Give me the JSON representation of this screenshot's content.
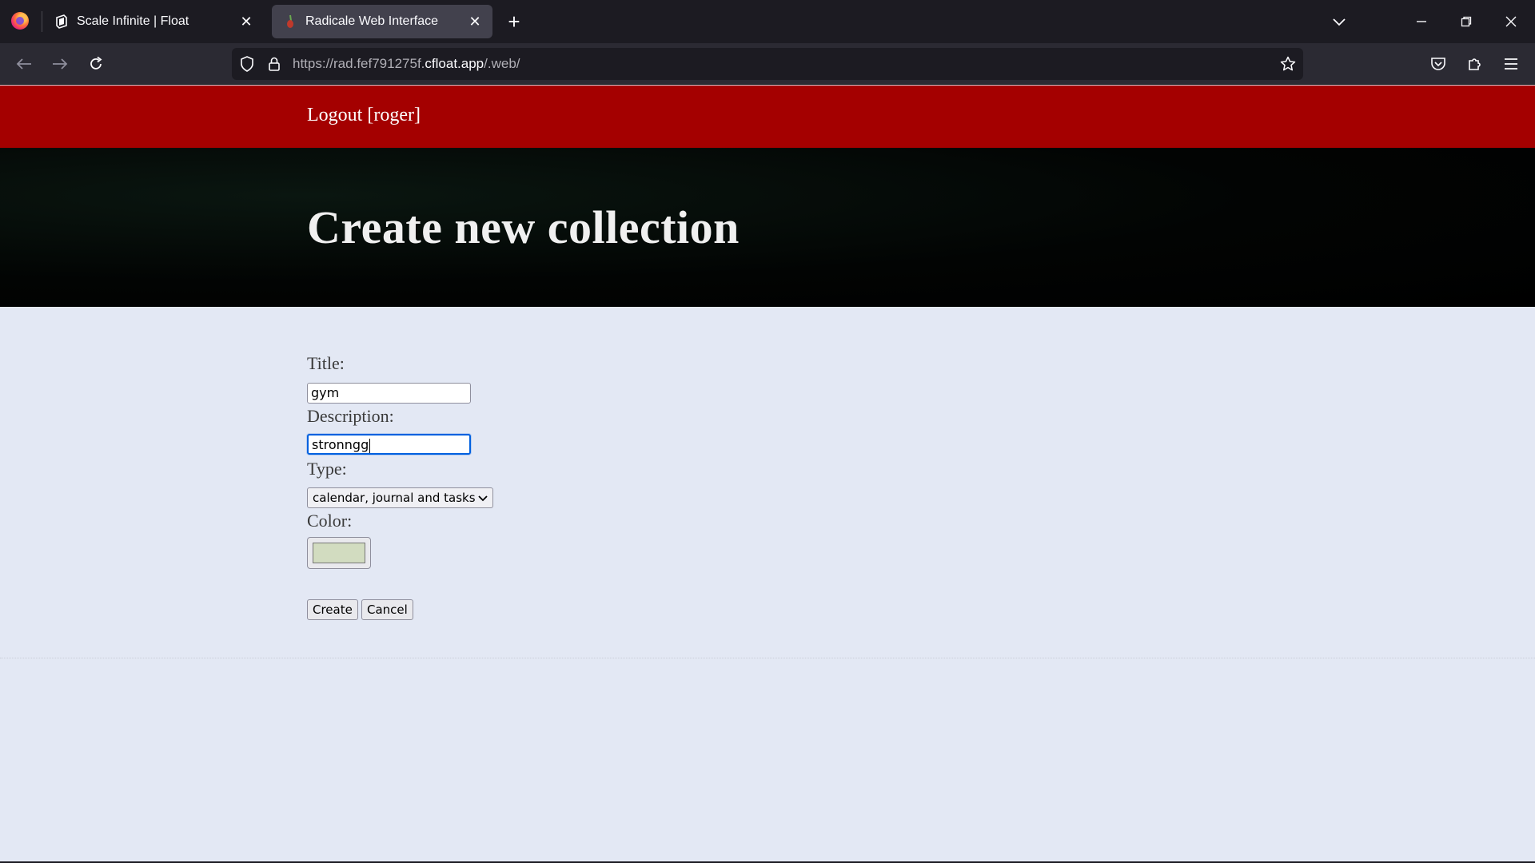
{
  "browser": {
    "tabs": [
      {
        "title": "Scale Infinite | Float",
        "active": false
      },
      {
        "title": "Radicale Web Interface",
        "active": true
      }
    ],
    "url": {
      "prefix": "https://rad.fef791275f.",
      "host": "cfloat.app",
      "suffix": "/.web/"
    }
  },
  "header": {
    "logout_label": "Logout [roger]"
  },
  "hero": {
    "title": "Create new collection"
  },
  "form": {
    "title_label": "Title:",
    "title_value": "gym",
    "description_label": "Description:",
    "description_value": "stronngg",
    "type_label": "Type:",
    "type_value": "calendar, journal and tasks",
    "color_label": "Color:",
    "color_value": "#d2dcc0",
    "create_label": "Create",
    "cancel_label": "Cancel"
  },
  "colors": {
    "header_bar": "#a40000",
    "page_bg": "#e3e8f4",
    "focus_ring": "#0060df"
  }
}
